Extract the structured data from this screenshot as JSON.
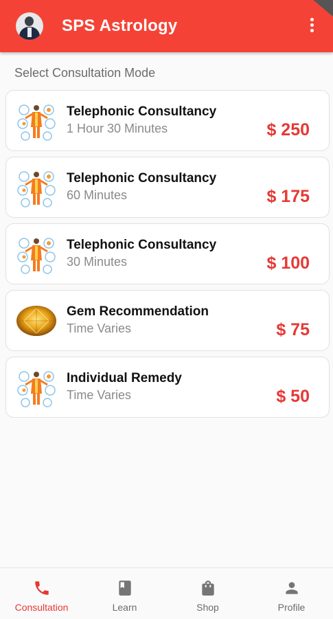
{
  "app": {
    "title": "SPS Astrology"
  },
  "section": {
    "title": "Select Consultation Mode"
  },
  "services": [
    {
      "name": "Telephonic Consultancy",
      "duration": "1 Hour 30 Minutes",
      "price": "$ 250",
      "icon": "astrologer-icon"
    },
    {
      "name": "Telephonic Consultancy",
      "duration": "60 Minutes",
      "price": "$ 175",
      "icon": "astrologer-icon"
    },
    {
      "name": "Telephonic Consultancy",
      "duration": "30 Minutes",
      "price": "$ 100",
      "icon": "astrologer-icon"
    },
    {
      "name": "Gem Recommendation",
      "duration": "Time Varies",
      "price": "$ 75",
      "icon": "gemstone-icon"
    },
    {
      "name": "Individual Remedy",
      "duration": "Time Varies",
      "price": "$ 50",
      "icon": "astrologer-icon"
    }
  ],
  "bottom_nav": [
    {
      "label": "Consultation",
      "icon": "phone-icon",
      "active": true
    },
    {
      "label": "Learn",
      "icon": "book-icon",
      "active": false
    },
    {
      "label": "Shop",
      "icon": "shopping-bag-icon",
      "active": false
    },
    {
      "label": "Profile",
      "icon": "person-icon",
      "active": false
    }
  ],
  "colors": {
    "primary": "#f44336",
    "price": "#e53935",
    "background": "#fafafa"
  }
}
